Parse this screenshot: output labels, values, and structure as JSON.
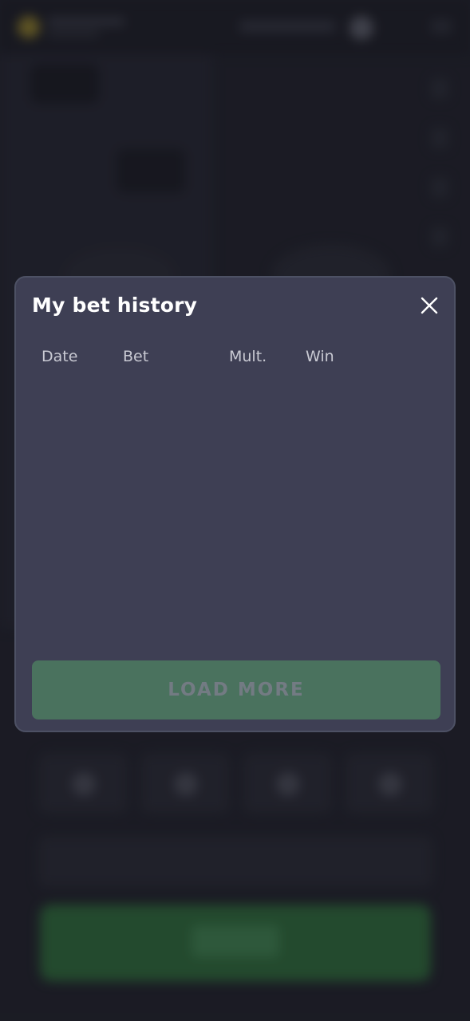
{
  "modal": {
    "title": "My bet history",
    "close_icon": "close-icon",
    "columns": [
      "Date",
      "Bet",
      "Mult.",
      "Win"
    ],
    "rows": [],
    "load_more_label": "LOAD MORE"
  },
  "colors": {
    "modal_bg": "#3e3f54",
    "button_bg": "#4a725e",
    "page_bg": "#22232d"
  }
}
